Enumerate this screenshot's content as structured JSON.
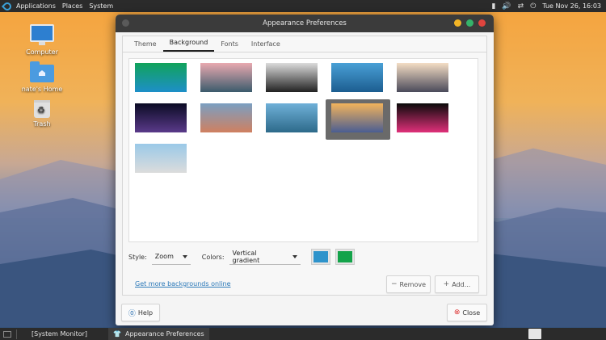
{
  "top_panel": {
    "menus": [
      "Applications",
      "Places",
      "System"
    ],
    "datetime": "Tue Nov 26, 16:03"
  },
  "desktop": {
    "icons": [
      {
        "label": "Computer",
        "icon": "computer-icon"
      },
      {
        "label": "nate's Home",
        "icon": "home-folder-icon"
      },
      {
        "label": "Trash",
        "icon": "trash-icon"
      }
    ]
  },
  "window": {
    "title": "Appearance Preferences",
    "tabs": [
      {
        "label": "Theme",
        "active": false
      },
      {
        "label": "Background",
        "active": true
      },
      {
        "label": "Fonts",
        "active": false
      },
      {
        "label": "Interface",
        "active": false
      }
    ],
    "thumbnails": [
      {
        "name": "green-gradient",
        "colors": [
          "#11a35b",
          "#1d8fc9"
        ]
      },
      {
        "name": "rocks-in-clouds",
        "colors": [
          "#e9a9b0",
          "#3b5b6c"
        ]
      },
      {
        "name": "mono-mountains",
        "colors": [
          "#dcdcdc",
          "#222"
        ]
      },
      {
        "name": "glass-building",
        "colors": [
          "#49a0d6",
          "#1c5d90"
        ]
      },
      {
        "name": "city-skyline-water",
        "colors": [
          "#f4ddc4",
          "#4a4a5a"
        ]
      },
      {
        "name": "comet-nebula",
        "colors": [
          "#0b0b24",
          "#5a3a8a"
        ]
      },
      {
        "name": "moon-mountain",
        "colors": [
          "#7a9fc2",
          "#d08060"
        ]
      },
      {
        "name": "coastal-rocks",
        "colors": [
          "#6fb0d8",
          "#2d6a8a"
        ]
      },
      {
        "name": "sunset-mountains",
        "colors": [
          "#f2b35b",
          "#4a5d92"
        ],
        "selected": true
      },
      {
        "name": "pink-laptop",
        "colors": [
          "#0a0a0a",
          "#e0307a"
        ]
      },
      {
        "name": "snowy-ridge",
        "colors": [
          "#9ac9e8",
          "#dcdcdc"
        ]
      }
    ],
    "style_label": "Style:",
    "style_value": "Zoom",
    "colors_label": "Colors:",
    "colors_value": "Vertical gradient",
    "color1": "#2e93cb",
    "color2": "#13a34a",
    "link_text": "Get more backgrounds online",
    "remove_label": "Remove",
    "add_label": "Add...",
    "help_label": "Help",
    "close_label": "Close"
  },
  "bottom_panel": {
    "tasks": [
      {
        "label": "[System Monitor]",
        "active": false
      },
      {
        "label": "Appearance Preferences",
        "active": true
      }
    ]
  }
}
